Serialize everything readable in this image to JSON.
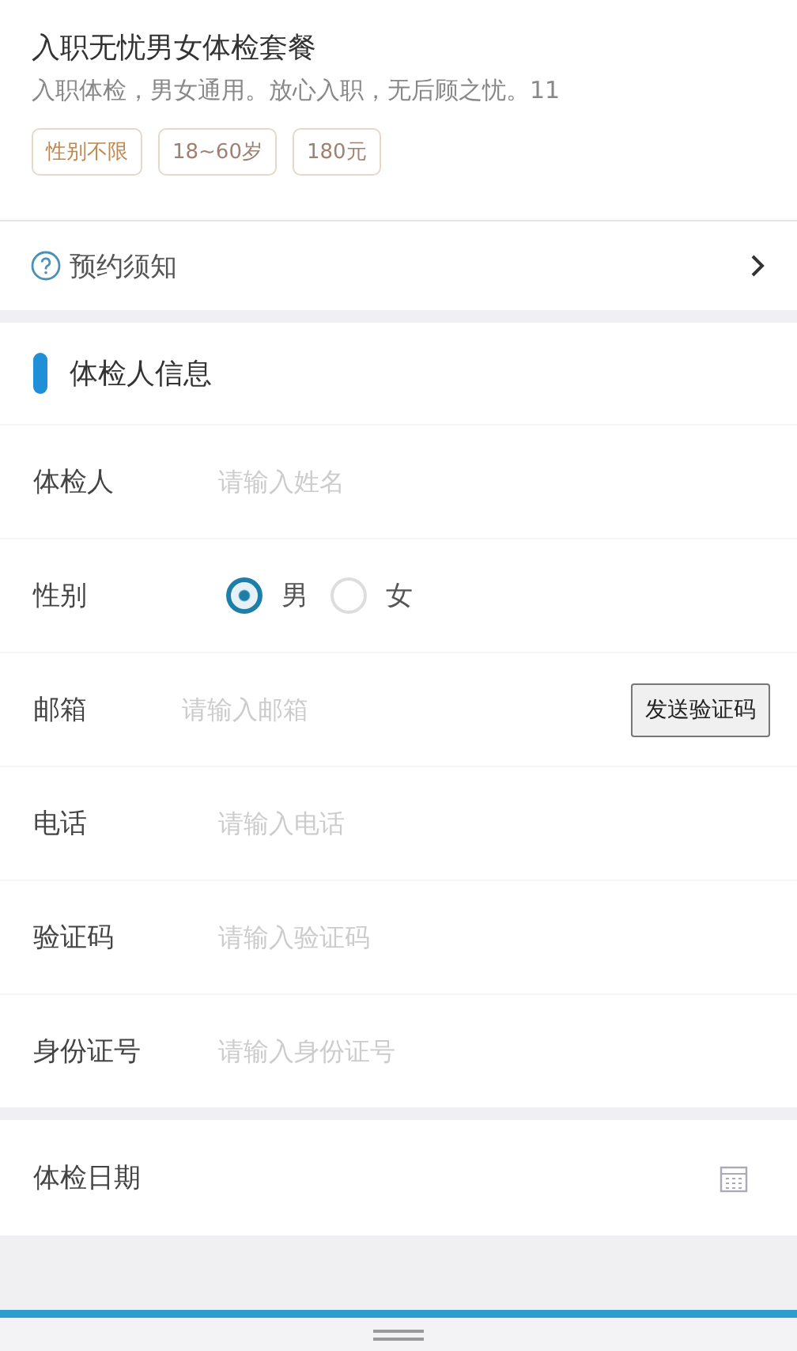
{
  "package": {
    "title": "入职无忧男女体检套餐",
    "description": "入职体检，男女通用。放心入职，无后顾之忧。11",
    "tags": [
      "性别不限",
      "18~60岁",
      "180元"
    ]
  },
  "notice": {
    "label": "预约须知"
  },
  "section": {
    "title": "体检人信息"
  },
  "fields": [
    {
      "kind": "text",
      "label": "体检人",
      "placeholder": "请输入姓名"
    },
    {
      "kind": "radio",
      "label": "性别",
      "options": [
        {
          "label": "男",
          "selected": true
        },
        {
          "label": "女",
          "selected": false
        }
      ]
    },
    {
      "kind": "code",
      "label": "邮箱",
      "placeholder": "请输入邮箱",
      "button": "发送验证码"
    },
    {
      "kind": "text",
      "label": "电话",
      "placeholder": "请输入电话"
    },
    {
      "kind": "text",
      "label": "验证码",
      "placeholder": "请输入验证码"
    },
    {
      "kind": "text",
      "label": "身份证号",
      "placeholder": "请输入身份证号"
    }
  ],
  "date": {
    "label": "体检日期"
  }
}
